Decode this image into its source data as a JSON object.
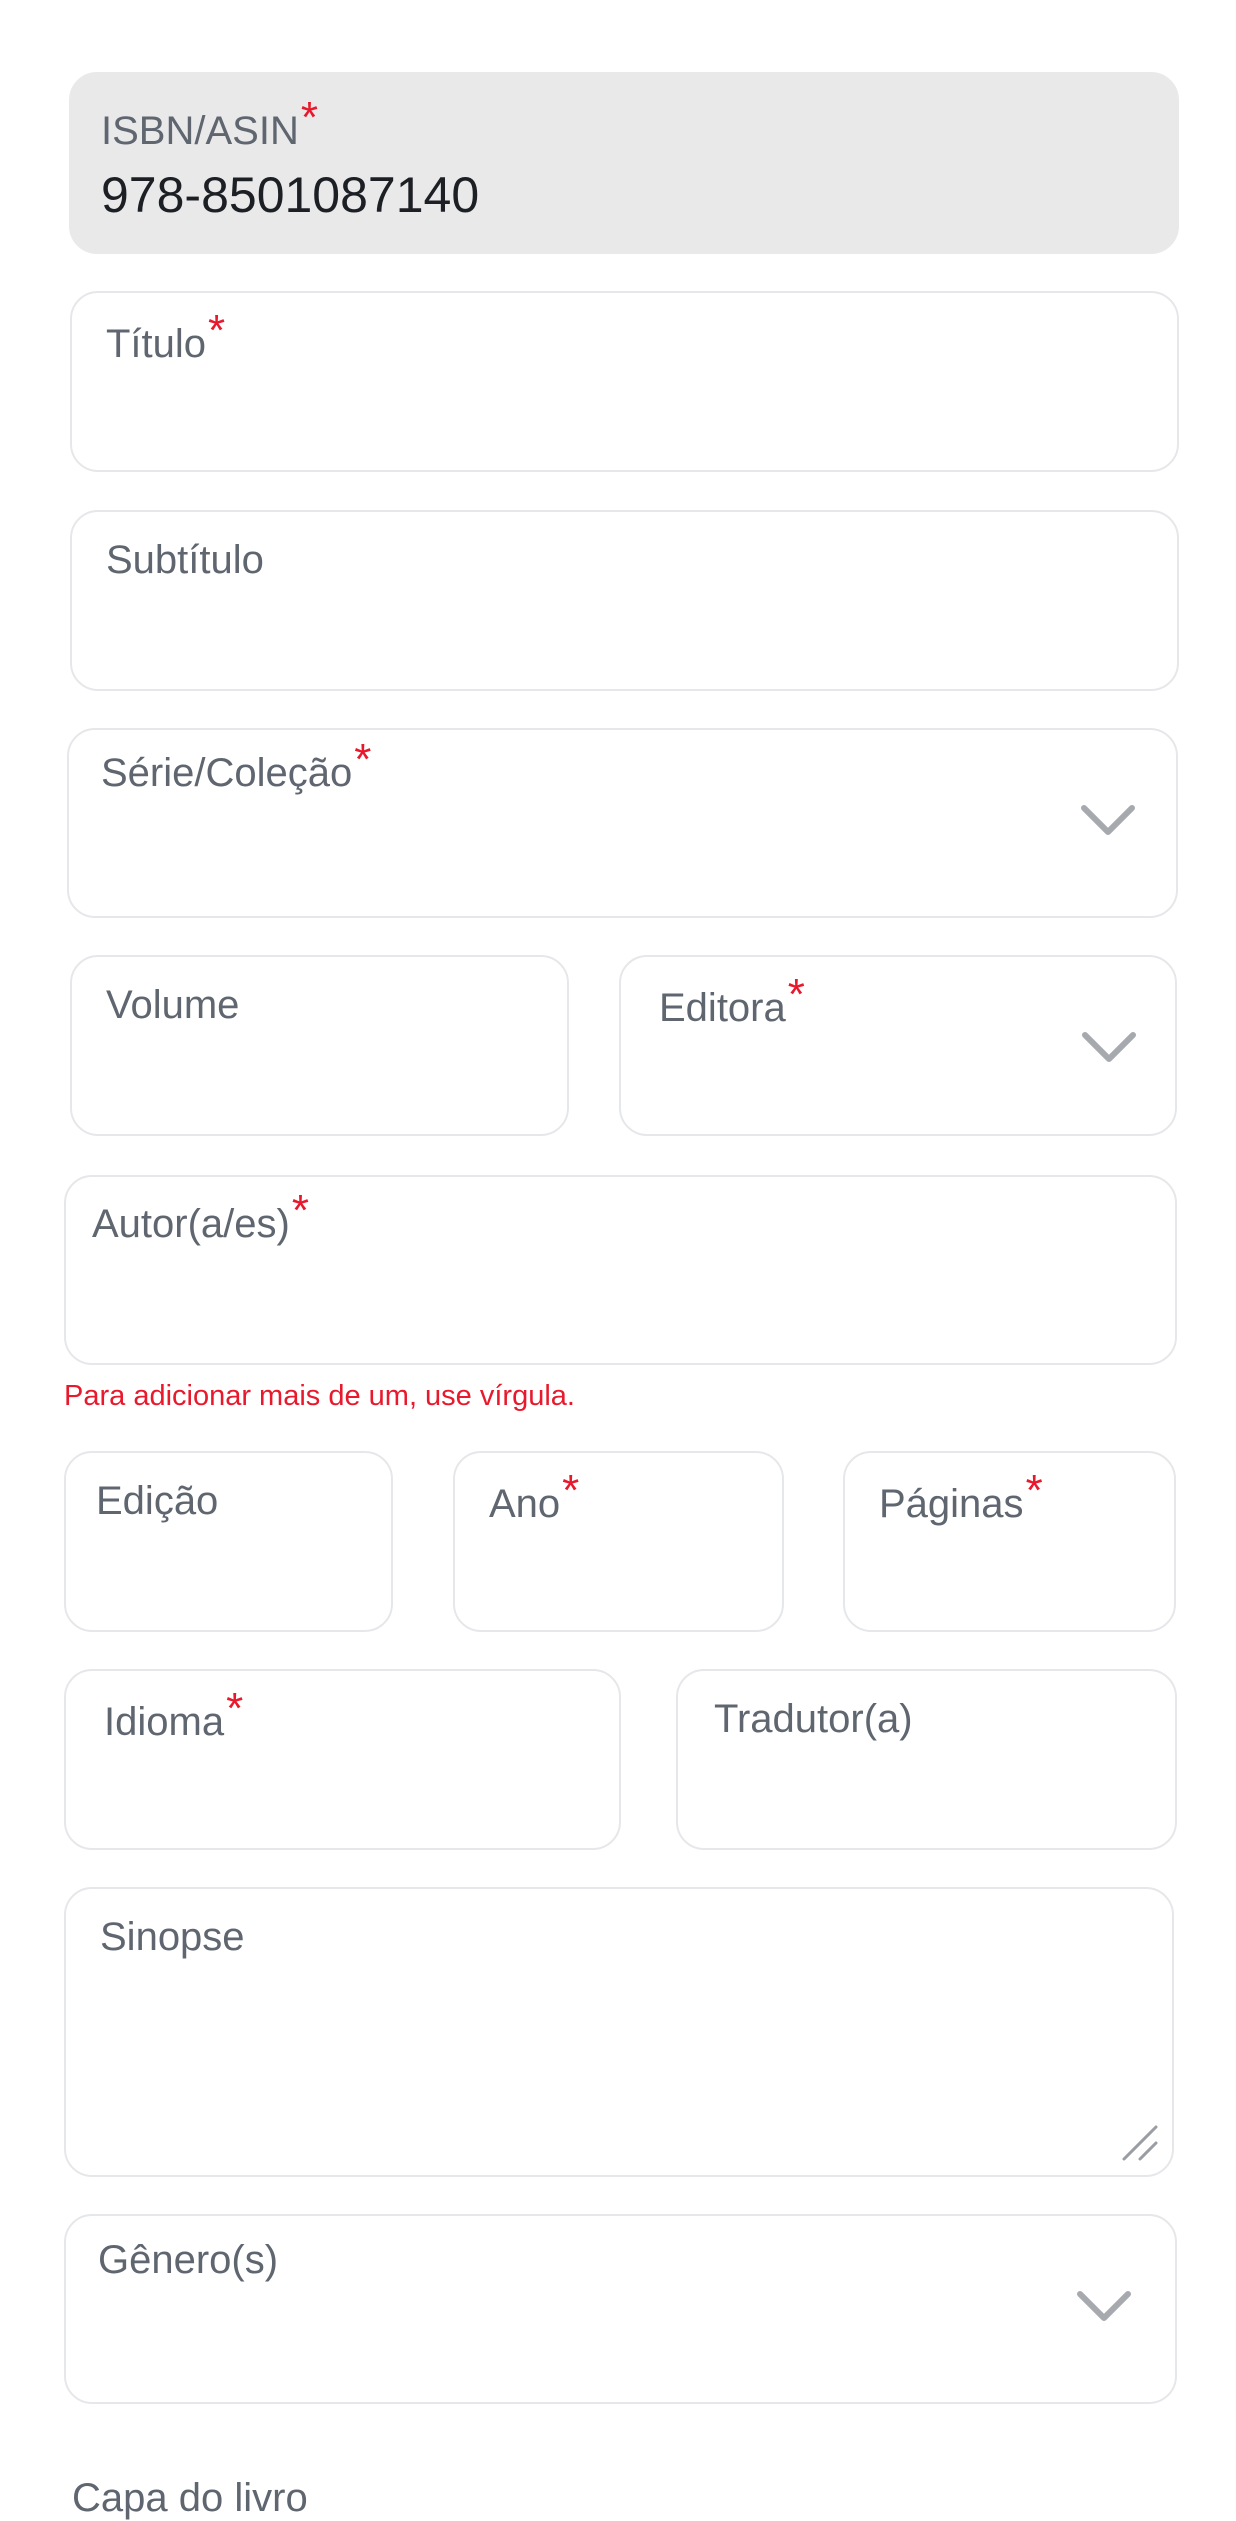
{
  "form": {
    "isbn": {
      "label": "ISBN/ASIN",
      "required_mark": "*",
      "value": "978-8501087140"
    },
    "titulo": {
      "label": "Título",
      "required_mark": "*"
    },
    "subtitulo": {
      "label": "Subtítulo"
    },
    "serie": {
      "label": "Série/Coleção",
      "required_mark": "*",
      "icon": "chevron-down-icon"
    },
    "volume": {
      "label": "Volume"
    },
    "editora": {
      "label": "Editora",
      "required_mark": "*",
      "icon": "chevron-down-icon"
    },
    "autores": {
      "label": "Autor(a/es)",
      "required_mark": "*",
      "hint": "Para adicionar mais de um, use vírgula."
    },
    "edicao": {
      "label": "Edição"
    },
    "ano": {
      "label": "Ano",
      "required_mark": "*"
    },
    "paginas": {
      "label": "Páginas",
      "required_mark": "*"
    },
    "idioma": {
      "label": "Idioma",
      "required_mark": "*"
    },
    "tradutor": {
      "label": "Tradutor(a)"
    },
    "sinopse": {
      "label": "Sinopse",
      "icon": "resize-handle-icon"
    },
    "generos": {
      "label": "Gênero(s)",
      "icon": "chevron-down-icon"
    },
    "capa": {
      "label": "Capa do livro"
    }
  },
  "colors": {
    "required": "#e8192c",
    "border": "#e6e7ea",
    "filled_bg": "#e9e9ea",
    "label": "#5f6670",
    "value": "#1c1f24"
  }
}
